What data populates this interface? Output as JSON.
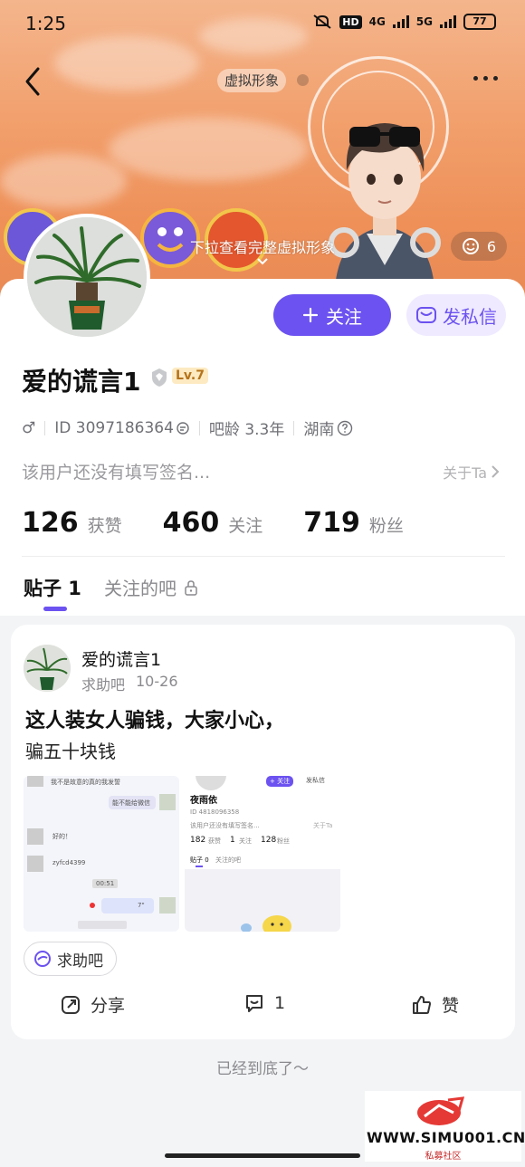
{
  "status_bar": {
    "time": "1:25",
    "network_1": "4G",
    "network_2": "5G",
    "hd_label": "HD",
    "battery": "77"
  },
  "header": {
    "avatar_tag": "虚拟形象",
    "pull_hint": "下拉查看完整虚拟形象",
    "emoji_count": "6"
  },
  "profile": {
    "username": "爱的谎言1",
    "level": "Lv.7",
    "gender_symbol": "♂",
    "id_text": "ID 3097186364",
    "tieba_age": "吧龄 3.3年",
    "location": "湖南",
    "signature": "该用户还没有填写签名...",
    "about_link": "关于Ta",
    "follow_button": "关注",
    "message_button": "发私信",
    "stats": [
      {
        "num": "126",
        "label": "获赞"
      },
      {
        "num": "460",
        "label": "关注"
      },
      {
        "num": "719",
        "label": "粉丝"
      }
    ],
    "tabs": {
      "posts": "贴子 1",
      "followed_bars": "关注的吧"
    }
  },
  "post": {
    "author": "爱的谎言1",
    "bar_name": "求助吧",
    "date": "10-26",
    "title": "这人装女人骗钱，大家小心，",
    "body": "骗五十块钱",
    "bar_chip": "求助吧",
    "actions": {
      "share": "分享",
      "comments": "1",
      "like": "赞"
    },
    "thumb1": {
      "line1": "我不是故意的真的我发誓",
      "line2": "能不能给微信",
      "line3": "好的！",
      "line4": "zyfcd4399",
      "line5": "00:51",
      "line6": "7\""
    },
    "thumb2": {
      "name": "夜雨依",
      "id_line": "ID 4818096358",
      "sig": "该用户还没有填写签名...",
      "about": "关于Ta",
      "stat1": "182",
      "stat1_label": "获赞",
      "stat2": "1",
      "stat2_label": "关注",
      "stat3": "128",
      "stat3_label": "粉丝",
      "tab1": "贴子 0",
      "tab2": "关注的吧",
      "follow": "+ 关注",
      "msg": "发私信"
    }
  },
  "footer": {
    "end_text": "已经到底了～"
  },
  "watermark": {
    "url": "WWW.SIMU001.CN",
    "sub": "私募社区"
  },
  "colors": {
    "accent": "#6c52f0",
    "banner": "#f2a06d",
    "background": "#f3f4f6"
  }
}
